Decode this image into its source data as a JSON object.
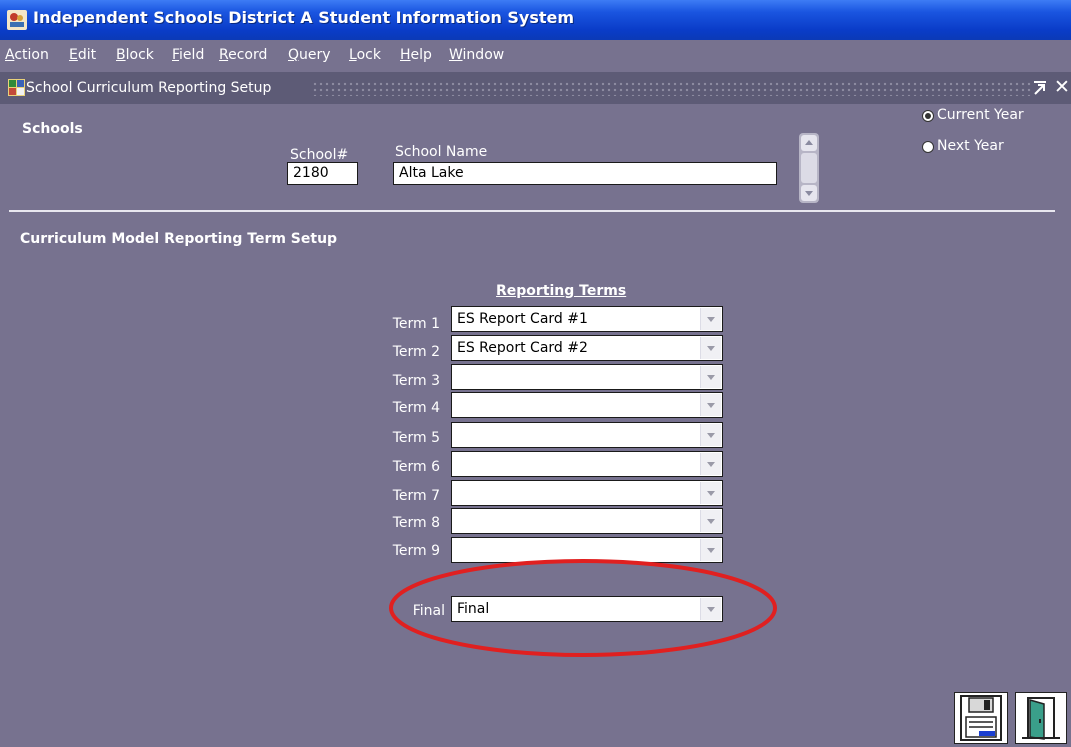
{
  "app": {
    "title": "Independent Schools District A Student Information System"
  },
  "menu": [
    {
      "mnemonic": "A",
      "rest": "ction"
    },
    {
      "mnemonic": "E",
      "rest": "dit"
    },
    {
      "mnemonic": "B",
      "rest": "lock"
    },
    {
      "mnemonic": "F",
      "rest": "ield"
    },
    {
      "mnemonic": "R",
      "rest": "ecord"
    },
    {
      "mnemonic": "Q",
      "rest": "uery"
    },
    {
      "mnemonic": "L",
      "rest": "ock"
    },
    {
      "mnemonic": "H",
      "rest": "elp"
    },
    {
      "mnemonic": "W",
      "rest": "indow"
    }
  ],
  "window": {
    "title": "School Curriculum Reporting Setup",
    "close_glyph": "✕"
  },
  "schools": {
    "section_title": "Schools",
    "school_number_label": "School#",
    "school_number": "2180",
    "school_name_label": "School Name",
    "school_name": "Alta Lake"
  },
  "year_options": {
    "current_year_label": "Current Year",
    "next_year_label": "Next Year",
    "selected": "current"
  },
  "curriculum": {
    "section_title": "Curriculum Model Reporting Term Setup",
    "reporting_terms_header": "Reporting Terms",
    "terms": [
      {
        "label": "Term 1",
        "value": "ES Report Card #1"
      },
      {
        "label": "Term 2",
        "value": "ES Report Card #2"
      },
      {
        "label": "Term 3",
        "value": ""
      },
      {
        "label": "Term 4",
        "value": ""
      },
      {
        "label": "Term 5",
        "value": ""
      },
      {
        "label": "Term 6",
        "value": ""
      },
      {
        "label": "Term 7",
        "value": ""
      },
      {
        "label": "Term 8",
        "value": ""
      },
      {
        "label": "Term 9",
        "value": ""
      }
    ],
    "final_label": "Final",
    "final_value": "Final"
  },
  "annotation": {
    "highlight_color": "#e02020"
  }
}
